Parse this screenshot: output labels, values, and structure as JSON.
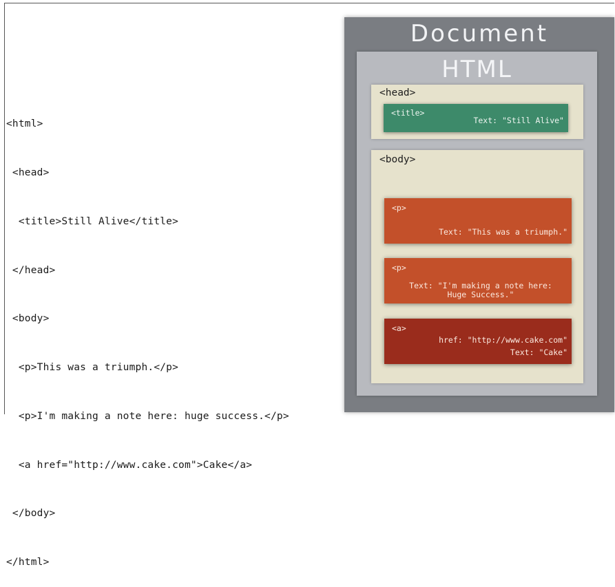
{
  "code": {
    "lines": [
      "<html>",
      " <head>",
      "  <title>Still Alive</title>",
      " </head>",
      " <body>",
      "  <p>This was a triumph.</p>",
      "  <p>I'm making a note here: huge success.</p>",
      "  <a href=\"http://www.cake.com\">Cake</a>",
      " </body>",
      "</html>"
    ]
  },
  "diagram": {
    "document_label": "Document",
    "html_label": "HTML",
    "head": {
      "label": "<head>",
      "title_element": {
        "tag": "<title>",
        "text": "Text: \"Still Alive\""
      }
    },
    "body": {
      "label": "<body>",
      "p1": {
        "tag": "<p>",
        "text": "Text: \"This was a triumph.\""
      },
      "p2": {
        "tag": "<p>",
        "text_line1": "Text: \"I'm making a note here:",
        "text_line2": "Huge Success.\""
      },
      "a": {
        "tag": "<a>",
        "href": "href: \"http://www.cake.com\"",
        "text": "Text: \"Cake\""
      }
    }
  },
  "colors": {
    "document_bg": "#7a7d82",
    "html_bg": "#b8babf",
    "section_bg": "#e6e2cc",
    "title_green": "#3d8a6a",
    "p_orange": "#c3502a",
    "a_red": "#9a2c1c"
  }
}
